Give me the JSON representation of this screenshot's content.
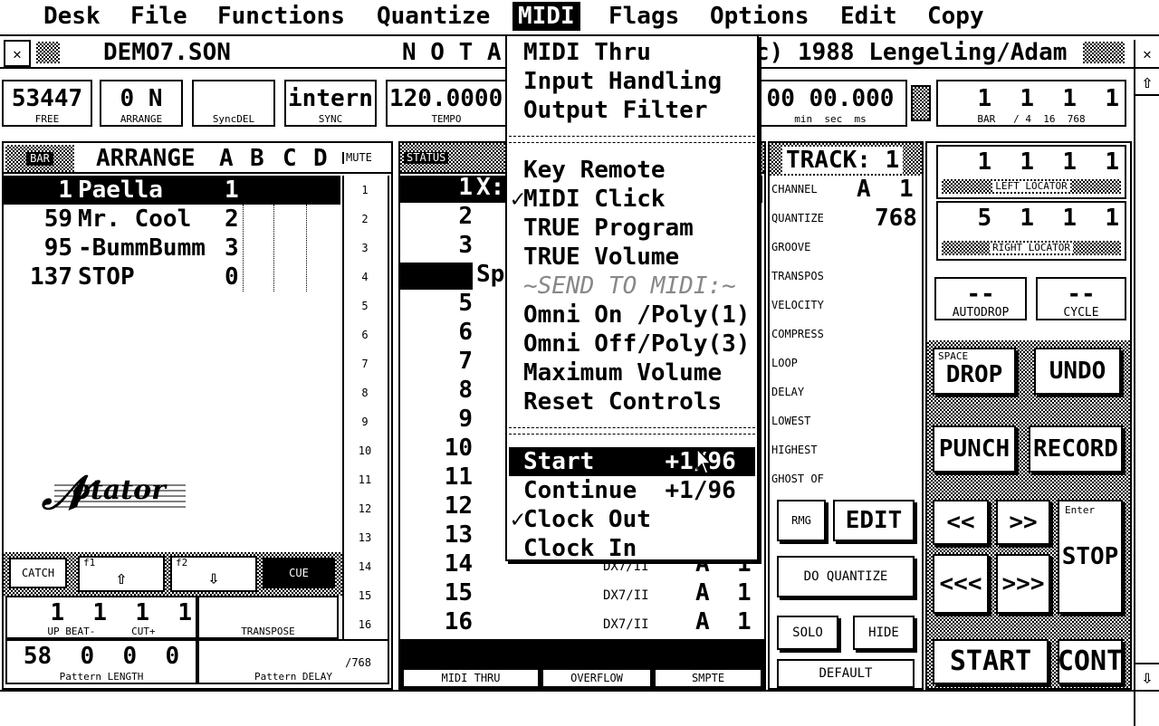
{
  "menubar": [
    "Desk",
    "File",
    "Functions",
    "Quantize",
    "MIDI",
    "Flags",
    "Options",
    "Edit",
    "Copy"
  ],
  "menubar_active": "MIDI",
  "titlebar": {
    "filename": "DEMO7.SON",
    "center": "N O T A",
    "right": "c) 1988 Lengeling/Adam"
  },
  "status": {
    "free": {
      "value": "53447",
      "label": "FREE"
    },
    "arrange": {
      "value": "0 N",
      "label": "ARRANGE"
    },
    "syncdel": {
      "value": "",
      "label": "SyncDEL"
    },
    "sync": {
      "value": "intern",
      "label": "SYNC"
    },
    "tempo": {
      "value": "120.0000",
      "label": "TEMPO"
    },
    "time": {
      "value": "00 00.000",
      "labels": "min  sec  ms"
    },
    "bar": {
      "value": "1  1  1  1",
      "labels": "BAR   / 4  16  768"
    }
  },
  "arrange": {
    "header": {
      "bar": "BAR",
      "title": "ARRANGE",
      "cols": [
        "A",
        "B",
        "C",
        "D"
      ],
      "mute": "MUTE"
    },
    "rows": [
      {
        "bar": "1",
        "name": "Paella",
        "val": "1"
      },
      {
        "bar": "59",
        "name": "Mr. Cool",
        "val": "2"
      },
      {
        "bar": "95",
        "name": "-BummBumm",
        "val": "3"
      },
      {
        "bar": "137",
        "name": "STOP",
        "val": "0"
      }
    ],
    "track_numbers": [
      "1",
      "2",
      "3",
      "4",
      "5",
      "6",
      "7",
      "8",
      "9",
      "10",
      "11",
      "12",
      "13",
      "14",
      "15",
      "16"
    ],
    "logo": "Notator",
    "buttons": {
      "catch": "CATCH",
      "f1": "f1",
      "f2": "f2",
      "cue": "CUE"
    },
    "upbeat": {
      "value": "1  1  1  1",
      "label": "UP BEAT-      CUT+"
    },
    "transpose": {
      "label": "TRANSPOSE"
    },
    "pattern_length": {
      "value": "58  0  0  0",
      "label": "Pattern LENGTH"
    },
    "pattern_delay": {
      "value": "/768",
      "label": "Pattern DELAY"
    }
  },
  "tracks": {
    "header": {
      "status": "STATUS"
    },
    "rows": [
      {
        "num": "1",
        "name": "X:",
        "inst": "",
        "ch": "",
        "ch2": ""
      },
      {
        "num": "2",
        "name": "",
        "inst": "",
        "ch": "",
        "ch2": ""
      },
      {
        "num": "3",
        "name": "",
        "inst": "",
        "ch": "",
        "ch2": ""
      },
      {
        "num": "4",
        "name": "Sp",
        "inst": "",
        "ch": "",
        "ch2": ""
      },
      {
        "num": "5",
        "name": "",
        "inst": "",
        "ch": "",
        "ch2": ""
      },
      {
        "num": "6",
        "name": "",
        "inst": "",
        "ch": "",
        "ch2": ""
      },
      {
        "num": "7",
        "name": "",
        "inst": "",
        "ch": "",
        "ch2": ""
      },
      {
        "num": "8",
        "name": "",
        "inst": "",
        "ch": "",
        "ch2": ""
      },
      {
        "num": "9",
        "name": "",
        "inst": "",
        "ch": "",
        "ch2": ""
      },
      {
        "num": "10",
        "name": "",
        "inst": "",
        "ch": "",
        "ch2": ""
      },
      {
        "num": "11",
        "name": "",
        "inst": "",
        "ch": "",
        "ch2": ""
      },
      {
        "num": "12",
        "name": "",
        "inst": "",
        "ch": "",
        "ch2": ""
      },
      {
        "num": "13",
        "name": "",
        "inst": "",
        "ch": "",
        "ch2": ""
      },
      {
        "num": "14",
        "name": "",
        "inst": "DX7/II",
        "ch": "A",
        "ch2": "1"
      },
      {
        "num": "15",
        "name": "",
        "inst": "DX7/II",
        "ch": "A",
        "ch2": "1"
      },
      {
        "num": "16",
        "name": "",
        "inst": "DX7/II",
        "ch": "A",
        "ch2": "1"
      }
    ],
    "footer": [
      "MIDI THRU",
      "OVERFLOW",
      "SMPTE"
    ]
  },
  "track_params": {
    "title": "TRACK: 1",
    "channel": {
      "label": "CHANNEL",
      "value": "A  1"
    },
    "quantize": {
      "label": "QUANTIZE",
      "value": "768"
    },
    "others": [
      "GROOVE",
      "TRANSPOS",
      "VELOCITY",
      "COMPRESS",
      "LOOP",
      "DELAY",
      "LOWEST",
      "HIGHEST",
      "GHOST OF"
    ],
    "buttons": {
      "rmg": "RMG",
      "edit": "EDIT",
      "do_quantize": "DO QUANTIZE",
      "solo": "SOLO",
      "hide": "HIDE",
      "default": "DEFAULT"
    }
  },
  "transport": {
    "left_locator": {
      "value": "1  1  1  1",
      "label": "LEFT LOCATOR"
    },
    "right_locator": {
      "value": "5  1  1  1",
      "label": "RIGHT LOCATOR"
    },
    "autodrop": {
      "value": "--",
      "label": "AUTODROP"
    },
    "cycle": {
      "value": "--",
      "label": "CYCLE"
    },
    "drop": {
      "label": "DROP",
      "hint": "SPACE"
    },
    "undo": "UNDO",
    "punch": "PUNCH",
    "record": "RECORD",
    "rew": "<<",
    "ff": ">>",
    "rew_fast": "<<<",
    "ff_fast": ">>>",
    "stop": {
      "label": "STOP",
      "hint": "Enter"
    },
    "start": "START",
    "cont": "CONT"
  },
  "midi_menu": {
    "items": [
      {
        "label": "MIDI Thru",
        "check": false,
        "type": "item"
      },
      {
        "label": "Input Handling",
        "check": false,
        "type": "item"
      },
      {
        "label": "Output Filter",
        "check": false,
        "type": "item"
      },
      {
        "type": "sep"
      },
      {
        "label": "Key Remote",
        "check": false,
        "type": "item"
      },
      {
        "label": "MIDI Click",
        "check": true,
        "type": "item"
      },
      {
        "label": "TRUE Program",
        "check": false,
        "type": "item"
      },
      {
        "label": "TRUE Volume",
        "check": false,
        "type": "item"
      },
      {
        "label": "~SEND TO MIDI:~",
        "check": false,
        "type": "disabled"
      },
      {
        "label": "Omni On /Poly(1)",
        "check": false,
        "type": "item"
      },
      {
        "label": "Omni Off/Poly(3)",
        "check": false,
        "type": "item"
      },
      {
        "label": "Maximum Volume",
        "check": false,
        "type": "item"
      },
      {
        "label": "Reset Controls",
        "check": false,
        "type": "item"
      },
      {
        "type": "sep"
      },
      {
        "label": "Start     +1/96",
        "check": false,
        "type": "item",
        "highlight": true
      },
      {
        "label": "Continue  +1/96",
        "check": false,
        "type": "item"
      },
      {
        "label": "Clock Out",
        "check": true,
        "type": "item"
      },
      {
        "label": "Clock In",
        "check": false,
        "type": "item"
      }
    ]
  },
  "icons": {
    "close": "close-icon",
    "scroll_up": "arrow-up-icon",
    "scroll_down": "arrow-down-icon",
    "check": "✓"
  }
}
